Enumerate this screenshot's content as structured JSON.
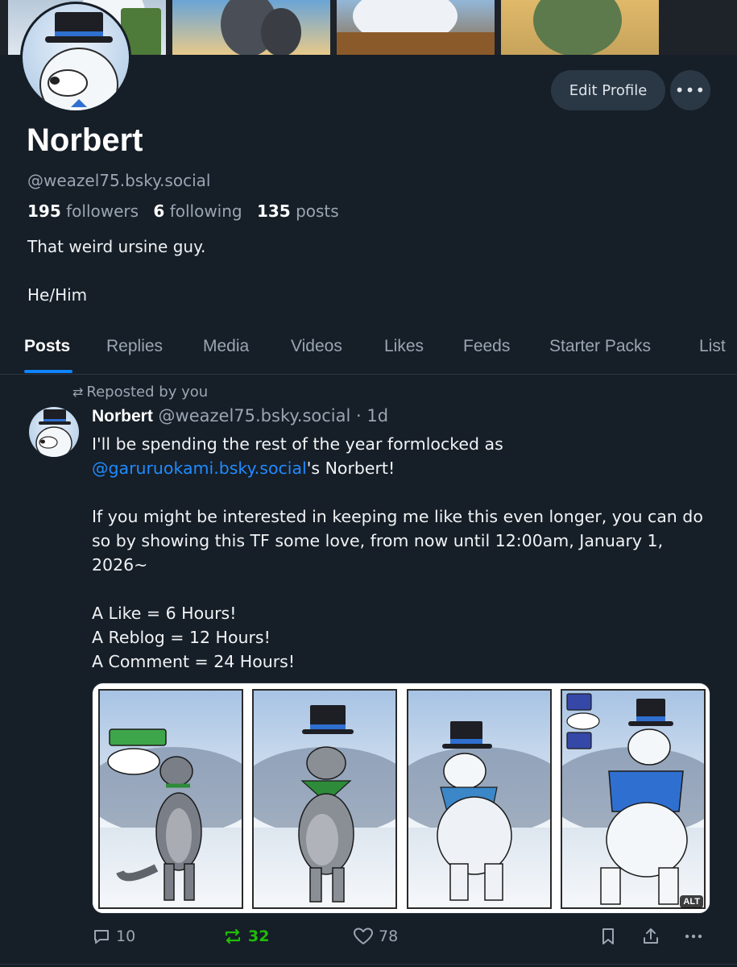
{
  "profile": {
    "display_name": "Norbert",
    "handle": "@weazel75.bsky.social",
    "followers_count": "195",
    "followers_label": "followers",
    "following_count": "6",
    "following_label": "following",
    "posts_count": "135",
    "posts_label": "posts",
    "bio_line1": "That weird ursine guy.",
    "bio_line2": "He/Him",
    "edit_profile_label": "Edit Profile",
    "more_label": "•••"
  },
  "tabs": [
    {
      "label": "Posts",
      "active": true
    },
    {
      "label": "Replies"
    },
    {
      "label": "Media"
    },
    {
      "label": "Videos"
    },
    {
      "label": "Likes"
    },
    {
      "label": "Feeds"
    },
    {
      "label": "Starter Packs"
    },
    {
      "label": "List"
    }
  ],
  "post": {
    "repost_label": "Reposted by you",
    "author": "Norbert",
    "handle": "@weazel75.bsky.social",
    "time": "· 1d",
    "line1": "I'll be spending the rest of the year formlocked as",
    "mention": "@garuruokami.bsky.social",
    "line2_suffix": "'s Norbert!",
    "para2_line1": "If you might be interested in keeping me like this even longer, you can do",
    "para2_line2": "so by showing this TF some love, from now until 12:00am, January 1,",
    "para2_line3": "2026~",
    "list1": "A Like = 6 Hours!",
    "list2": "A Reblog = 12 Hours!",
    "list3": "A Comment = 24 Hours!",
    "alt_label": "ALT",
    "reply_count": "10",
    "repost_count": "32",
    "like_count": "78"
  },
  "colors": {
    "background": "#161e27",
    "accent": "#1083fe",
    "mention": "#208bfe",
    "repost_active": "#20bc07",
    "muted_text": "#9aa6b3"
  }
}
